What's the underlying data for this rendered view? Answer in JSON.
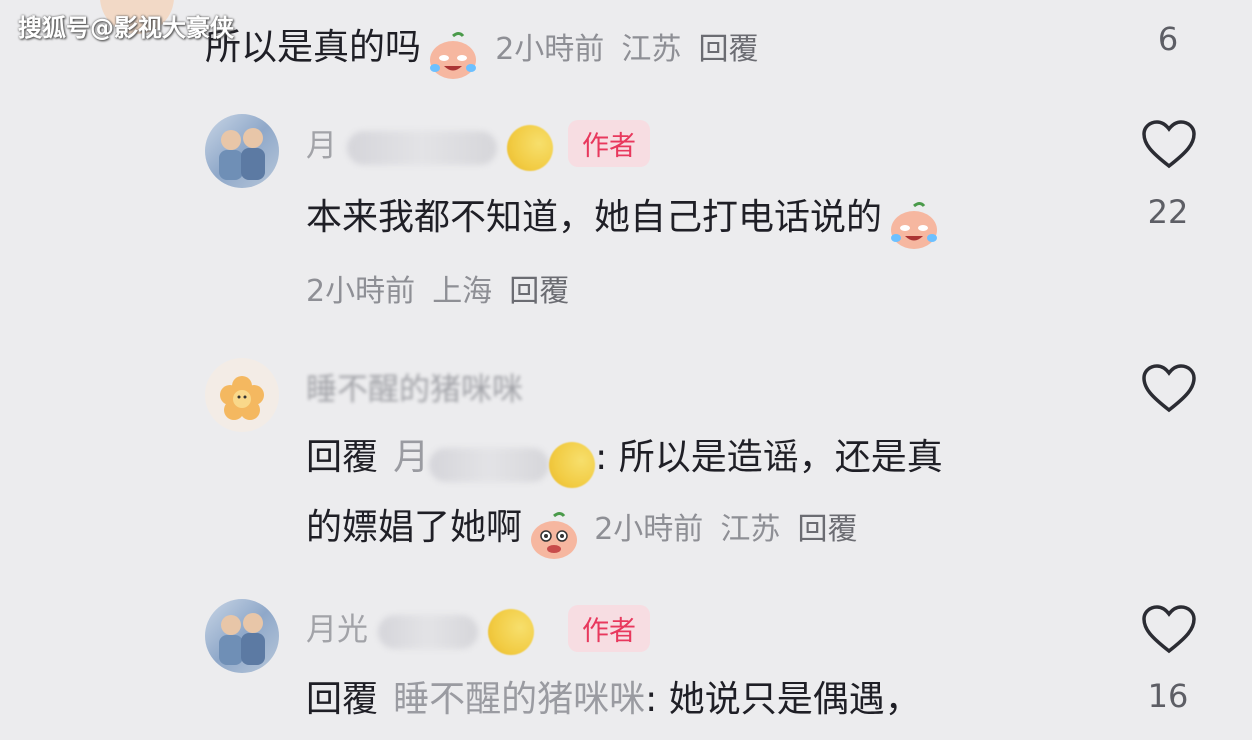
{
  "watermark": "搜狐号@影视大豪侠",
  "top_comment": {
    "text": "所以是真的吗",
    "emoji": "crying-laughing-peach-emoji",
    "time": "2小時前",
    "location": "江苏",
    "reply": "回覆",
    "likes": "6"
  },
  "comments": [
    {
      "username_visible": "月",
      "badge": "作者",
      "avatar": "people-avatar",
      "text": "本来我都不知道，她自己打电话说的",
      "emoji": "crying-laughing-peach-emoji",
      "time": "2小時前",
      "location": "上海",
      "reply": "回覆",
      "likes": "22"
    },
    {
      "username_visible": "睡不醒的猪咪咪",
      "avatar": "flower-avatar",
      "reply_prefix": "回覆",
      "reply_target": "月",
      "line1_text": ": 所以是造谣，还是真",
      "line2_text": "的嫖娼了她啊",
      "emoji": "thinking-peach-emoji",
      "time": "2小時前",
      "location": "江苏",
      "reply": "回覆"
    },
    {
      "username_visible": "月光",
      "badge": "作者",
      "avatar": "people-avatar",
      "reply_prefix": "回覆",
      "reply_target": "睡不醒的猪咪咪",
      "text": ": 她说只是偶遇，",
      "likes": "16"
    }
  ],
  "colors": {
    "background": "#ececee",
    "badge_text": "#e8385d",
    "badge_bg": "#f7dde2",
    "muted": "#8e8f95"
  }
}
